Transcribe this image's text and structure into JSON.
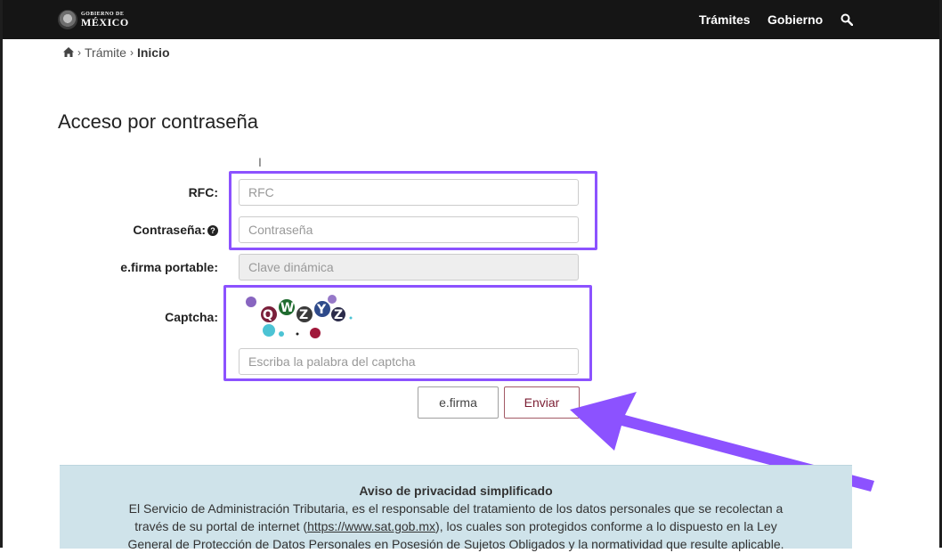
{
  "header": {
    "logo_small": "GOBIERNO DE",
    "logo_big": "MÉXICO",
    "nav": [
      "Trámites",
      "Gobierno"
    ],
    "search_icon": "search-icon"
  },
  "breadcrumb": {
    "home_icon": "home-icon",
    "items": [
      "Trámite",
      "Inicio"
    ]
  },
  "page": {
    "title": "Acceso por contraseña"
  },
  "form": {
    "rfc_label": "RFC:",
    "rfc_placeholder": "RFC",
    "password_label": "Contraseña:",
    "password_placeholder": "Contraseña",
    "efirma_label": "e.firma portable:",
    "efirma_placeholder": "Clave dinámica",
    "captcha_label": "Captcha:",
    "captcha_placeholder": "Escriba la palabra del captcha",
    "captcha_text": "QWZYZ"
  },
  "buttons": {
    "efirma": "e.firma",
    "enviar": "Enviar"
  },
  "privacy": {
    "title": "Aviso de privacidad simplificado",
    "line1": "El Servicio de Administración Tributaria, es el responsable del tratamiento de los datos personales que se recolectan a",
    "line2_pre": "través de su portal de internet (",
    "line2_link": "https://www.sat.gob.mx",
    "line2_post": "), los cuales son protegidos conforme a lo dispuesto en la Ley",
    "line3": "General de Protección de Datos Personales en Posesión de Sujetos Obligados y la normatividad que resulte aplicable."
  },
  "colors": {
    "highlight": "#8c52ff",
    "header_bg": "#151515",
    "enviar_text": "#7b1e33",
    "privacy_bg": "#cfe3ea"
  }
}
